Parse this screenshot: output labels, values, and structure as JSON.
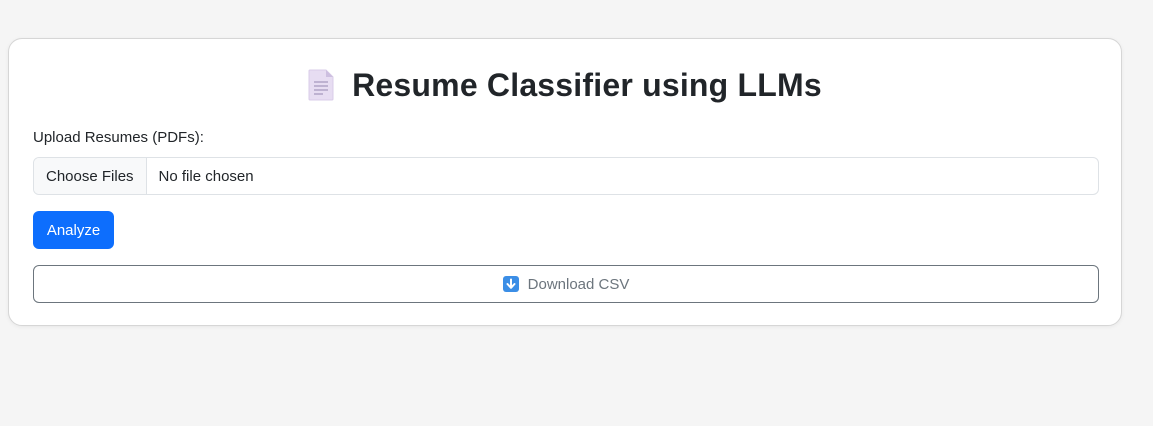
{
  "header": {
    "title": "Resume Classifier using LLMs",
    "icon": "document-icon"
  },
  "upload": {
    "label": "Upload Resumes (PDFs):",
    "choose_label": "Choose Files",
    "status": "No file chosen"
  },
  "actions": {
    "analyze_label": "Analyze",
    "download_label": "Download CSV",
    "download_icon": "down-arrow-icon"
  },
  "colors": {
    "primary": "#0d6efd",
    "secondary": "#6c757d",
    "background": "#f5f5f5"
  }
}
